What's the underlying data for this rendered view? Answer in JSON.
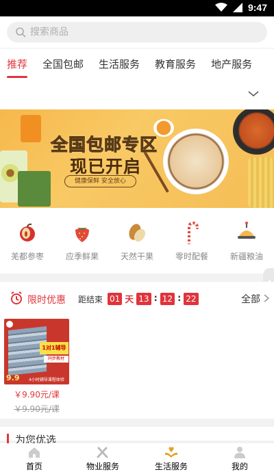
{
  "status_bar": {
    "time": "9:47"
  },
  "search": {
    "placeholder": "搜索商品"
  },
  "tabs": [
    {
      "label": "推荐",
      "active": true
    },
    {
      "label": "全国包邮",
      "active": false
    },
    {
      "label": "生活服务",
      "active": false
    },
    {
      "label": "教育服务",
      "active": false
    },
    {
      "label": "地产服务",
      "active": false
    }
  ],
  "banner": {
    "title_line1": "全国包邮专区",
    "title_line2": "现已开启",
    "subtitle": "健康保鲜  安全放心"
  },
  "categories": [
    {
      "label": "羌都参枣",
      "icon": "jujube-icon"
    },
    {
      "label": "应季鲜果",
      "icon": "strawberry-icon"
    },
    {
      "label": "天然干果",
      "icon": "almond-icon"
    },
    {
      "label": "零时配餐",
      "icon": "candy-cane-icon"
    },
    {
      "label": "新疆粮油",
      "icon": "food-dish-icon"
    }
  ],
  "flash_sale": {
    "title": "限时优惠",
    "ends_label": "距结束",
    "timer": {
      "days": "01",
      "day_unit": "天",
      "hours": "13",
      "minutes": "12",
      "seconds": "22"
    },
    "all_label": "全部",
    "product": {
      "badge": "1对1辅导",
      "badge_sub": "同步教材",
      "image_price": "9.9",
      "image_caption": "4小时辅导课程体验",
      "price": "￥9.90元/课",
      "original_price": "￥9.90元/课"
    }
  },
  "recommend": {
    "title": "为您优选"
  },
  "bottom_nav": [
    {
      "label": "首页",
      "icon": "home-icon"
    },
    {
      "label": "物业服务",
      "icon": "tools-icon"
    },
    {
      "label": "生活服务",
      "icon": "heart-hand-icon"
    },
    {
      "label": "我的",
      "icon": "user-icon"
    }
  ],
  "colors": {
    "accent": "#e0343c",
    "banner": "#f6b84c",
    "nav_active": "#e3a227"
  }
}
